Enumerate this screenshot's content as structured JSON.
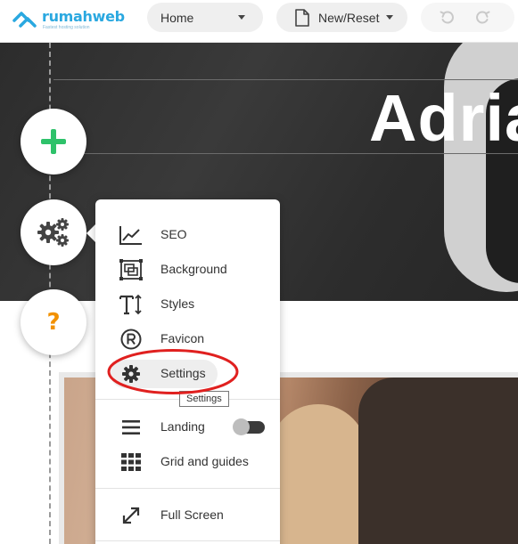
{
  "brand": {
    "name": "rumahweb",
    "tagline": "Fastest hosting solution",
    "color": "#2aa8e0"
  },
  "topbar": {
    "page_select": {
      "value": "Home",
      "icon": "caret-down-icon"
    },
    "new_reset": {
      "label": "New/Reset",
      "icon": "document-icon"
    },
    "undo_icon": "undo-icon",
    "redo_icon": "redo-icon"
  },
  "hero": {
    "title": "Adria"
  },
  "floating_buttons": {
    "add": {
      "icon": "plus-icon",
      "color": "#2ec26a"
    },
    "settings": {
      "icon": "gears-icon"
    },
    "help": {
      "glyph": "?",
      "color": "#f29100"
    }
  },
  "menu": {
    "items": [
      {
        "label": "SEO",
        "icon": "chart-line-icon"
      },
      {
        "label": "Background",
        "icon": "background-icon"
      },
      {
        "label": "Styles",
        "icon": "text-height-icon"
      },
      {
        "label": "Favicon",
        "icon": "registered-icon"
      },
      {
        "label": "Settings",
        "icon": "gear-icon",
        "highlighted": true
      },
      {
        "label": "Landing",
        "icon": "menu-lines-icon",
        "toggle": "on"
      },
      {
        "label": "Grid and guides",
        "icon": "grid-icon"
      },
      {
        "label": "Full Screen",
        "icon": "expand-icon"
      }
    ],
    "tooltip": "Settings"
  },
  "annotation": {
    "shape": "ellipse",
    "color": "#e0201f",
    "target": "Settings"
  }
}
